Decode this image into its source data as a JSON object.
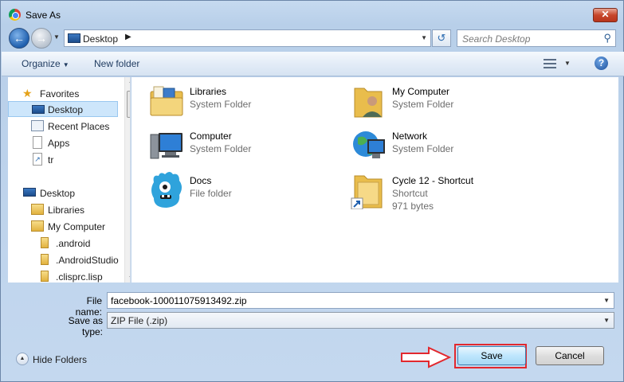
{
  "window": {
    "title": "Save As",
    "close_label": "✕"
  },
  "nav": {
    "back_icon": "back-arrow-icon",
    "forward_icon": "forward-arrow-icon",
    "address_crumb": "Desktop",
    "crumb_arrow": "▶",
    "search_placeholder": "Search Desktop"
  },
  "toolbar": {
    "organize_label": "Organize",
    "new_folder_label": "New folder"
  },
  "sidebar": {
    "items": [
      {
        "label": "Favorites",
        "icon": "star-icon"
      },
      {
        "label": "Desktop",
        "icon": "desktop-icon",
        "selected": true
      },
      {
        "label": "Recent Places",
        "icon": "recent-places-icon"
      },
      {
        "label": "Apps",
        "icon": "document-icon"
      },
      {
        "label": "tr",
        "icon": "shortcut-icon"
      },
      {
        "label": "Desktop",
        "icon": "desktop-icon"
      },
      {
        "label": "Libraries",
        "icon": "libraries-icon"
      },
      {
        "label": "My Computer",
        "icon": "user-folder-icon"
      },
      {
        "label": ".android",
        "icon": "folder-icon"
      },
      {
        "label": ".AndroidStudio",
        "icon": "folder-icon"
      },
      {
        "label": ".clisprc.lisp",
        "icon": "folder-icon"
      }
    ]
  },
  "files": [
    {
      "name": "Libraries",
      "type": "System Folder",
      "icon": "libraries-icon"
    },
    {
      "name": "My Computer",
      "type": "System Folder",
      "icon": "user-folder-icon"
    },
    {
      "name": "Computer",
      "type": "System Folder",
      "icon": "computer-icon"
    },
    {
      "name": "Network",
      "type": "System Folder",
      "icon": "network-icon"
    },
    {
      "name": "Docs",
      "type": "File folder",
      "icon": "monster-folder-icon"
    },
    {
      "name": "Cycle 12 - Shortcut",
      "type": "Shortcut",
      "size": "971 bytes",
      "icon": "folder-shortcut-icon"
    }
  ],
  "form": {
    "file_name_label": "File name:",
    "file_name_value": "facebook-100011075913492.zip",
    "save_type_label": "Save as type:",
    "save_type_value": "ZIP File (.zip)"
  },
  "footer": {
    "hide_folders_label": "Hide Folders",
    "save_label": "Save",
    "cancel_label": "Cancel"
  },
  "colors": {
    "highlight_box": "#e2282e",
    "annotation_arrow": "#e2282e",
    "selection": "#cde6fb"
  }
}
